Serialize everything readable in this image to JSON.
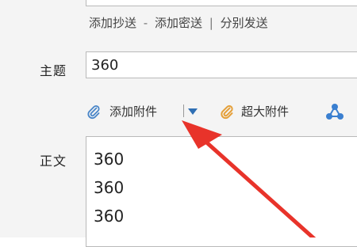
{
  "compose": {
    "cc_links": {
      "add_cc": "添加抄送",
      "separator_dash": "-",
      "add_bcc": "添加密送",
      "separator_bar": "|",
      "send_separately": "分别发送"
    },
    "subject": {
      "label": "主题",
      "value": "360"
    },
    "attachments": {
      "add_attachment": "添加附件",
      "large_attachment": "超大附件"
    },
    "body": {
      "label": "正文",
      "lines": [
        "360",
        "360",
        "360"
      ]
    }
  },
  "colors": {
    "panel_background": "#f4f4f4",
    "arrow": "#e8332a",
    "attach_icon_blue": "#4a86c8",
    "large_attach_icon_orange": "#e5a03a",
    "dropdown_blue": "#2f6fb4",
    "cloud_icon_blue": "#3a7fd0"
  },
  "icons": {
    "attachment": "paperclip-icon",
    "dropdown": "triangle-down-icon",
    "large_attachment": "paperclip-icon",
    "cloud_attachment": "share-nodes-icon"
  }
}
